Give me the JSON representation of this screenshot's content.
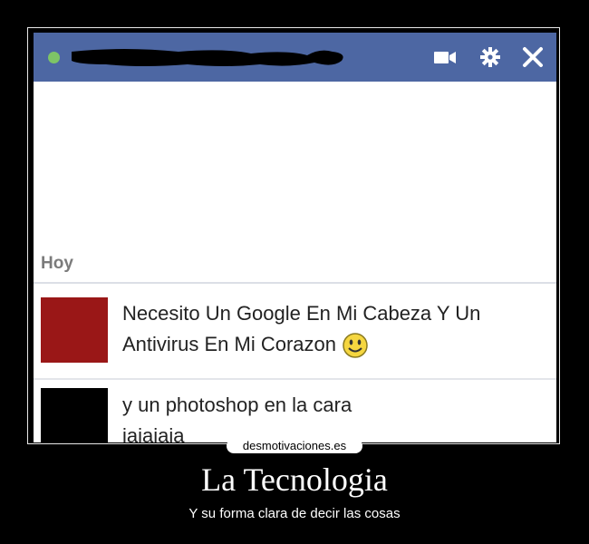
{
  "window": {
    "icons": [
      "video-call-icon",
      "gear-icon",
      "close-icon"
    ],
    "header_color": "#4d67a3",
    "online_color": "#7ec466"
  },
  "conversation": {
    "day_label": "Hoy",
    "messages": [
      {
        "lines": [
          "Necesito Un Google En Mi Cabeza Y Un",
          "Antivirus En Mi Corazon"
        ],
        "emoji": "smiley-icon",
        "avatar_color": "#9a1717"
      },
      {
        "lines": [
          "y un photoshop en la cara",
          "jajajaja"
        ],
        "avatar_color": "#000000"
      }
    ]
  },
  "footer": {
    "site": "desmotivaciones.es",
    "title": "La Tecnologia",
    "subtitle": "Y su forma clara de decir las cosas"
  }
}
